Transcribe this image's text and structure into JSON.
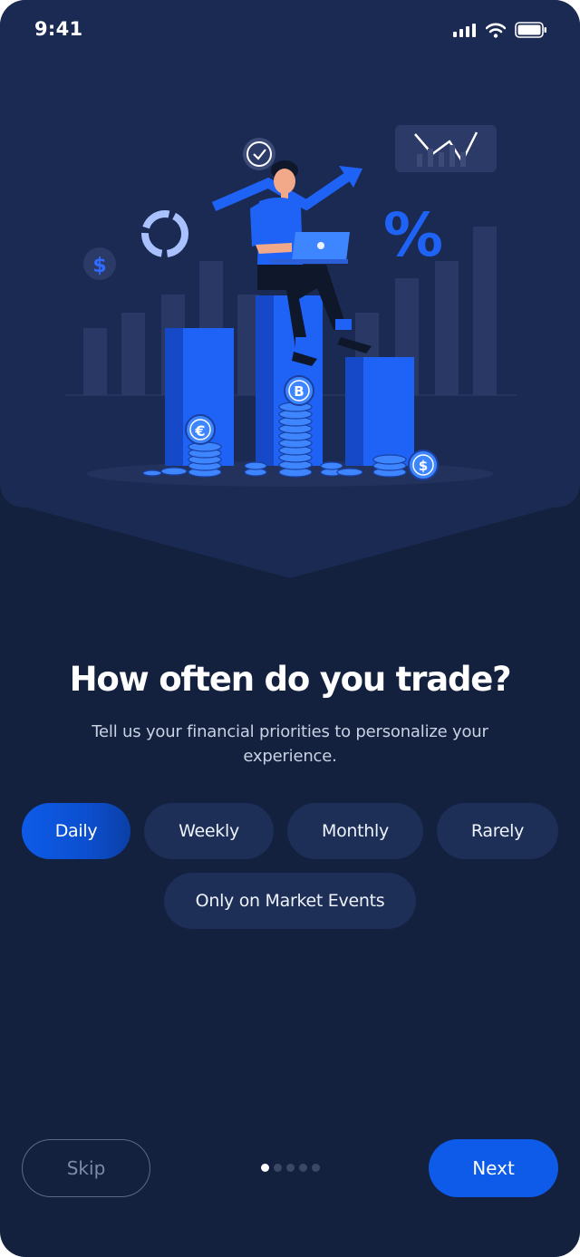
{
  "status_bar": {
    "time": "9:41"
  },
  "hero": {
    "dollar_symbol": "$",
    "percent_symbol": "%",
    "coin_euro": "€",
    "coin_bitcoin": "B",
    "coin_dollar": "$"
  },
  "question": {
    "title": "How often do you trade?",
    "subtitle": "Tell us your financial priorities to personalize your experience."
  },
  "options": [
    {
      "label": "Daily",
      "selected": true
    },
    {
      "label": "Weekly",
      "selected": false
    },
    {
      "label": "Monthly",
      "selected": false
    },
    {
      "label": "Rarely",
      "selected": false
    },
    {
      "label": "Only on Market Events",
      "selected": false
    }
  ],
  "pagination": {
    "total": 5,
    "current": 1
  },
  "footer": {
    "skip_label": "Skip",
    "next_label": "Next"
  },
  "colors": {
    "background": "#13213f",
    "hero_panel": "#1a2a52",
    "accent": "#0d5be8",
    "chip": "#1d2e57"
  }
}
